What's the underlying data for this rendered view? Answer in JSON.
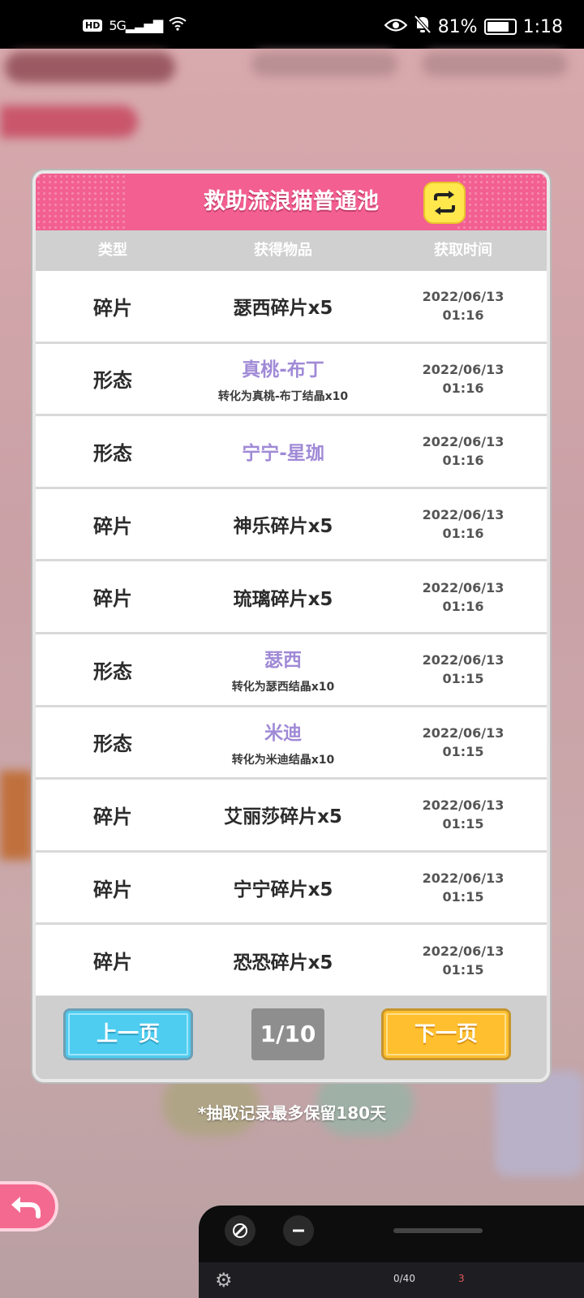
{
  "status_bar": {
    "hd": "HD",
    "network": "5G",
    "battery": "81%",
    "battery_level": 0.81,
    "time": "1:18"
  },
  "modal": {
    "title": "救助流浪猫普通池",
    "columns": {
      "type": "类型",
      "item": "获得物品",
      "time": "获取时间"
    },
    "rows": [
      {
        "type": "碎片",
        "item": "瑟西碎片x5",
        "sub": "",
        "date": "2022/06/13",
        "time": "01:16"
      },
      {
        "type": "形态",
        "item": "真桃-布丁",
        "sub": "转化为真桃-布丁结晶x10",
        "date": "2022/06/13",
        "time": "01:16"
      },
      {
        "type": "形态",
        "item": "宁宁-星珈",
        "sub": "",
        "date": "2022/06/13",
        "time": "01:16"
      },
      {
        "type": "碎片",
        "item": "神乐碎片x5",
        "sub": "",
        "date": "2022/06/13",
        "time": "01:16"
      },
      {
        "type": "碎片",
        "item": "琉璃碎片x5",
        "sub": "",
        "date": "2022/06/13",
        "time": "01:16"
      },
      {
        "type": "形态",
        "item": "瑟西",
        "sub": "转化为瑟西结晶x10",
        "date": "2022/06/13",
        "time": "01:15"
      },
      {
        "type": "形态",
        "item": "米迪",
        "sub": "转化为米迪结晶x10",
        "date": "2022/06/13",
        "time": "01:15"
      },
      {
        "type": "碎片",
        "item": "艾丽莎碎片x5",
        "sub": "",
        "date": "2022/06/13",
        "time": "01:15"
      },
      {
        "type": "碎片",
        "item": "宁宁碎片x5",
        "sub": "",
        "date": "2022/06/13",
        "time": "01:15"
      },
      {
        "type": "碎片",
        "item": "恐恐碎片x5",
        "sub": "",
        "date": "2022/06/13",
        "time": "01:15"
      }
    ],
    "pager": {
      "prev_label": "上一页",
      "page": "1/10",
      "next_label": "下一页"
    }
  },
  "retention_note": "*抽取记录最多保留180天",
  "floating_window": {
    "stat_a": "0/40",
    "stat_b": "3"
  },
  "colors": {
    "header_pink": "#f25f90",
    "form_purple": "#a08ad6",
    "prev_blue": "#4fcdf0",
    "next_orange": "#ffbf2e",
    "switch_yellow": "#ffe74c"
  }
}
